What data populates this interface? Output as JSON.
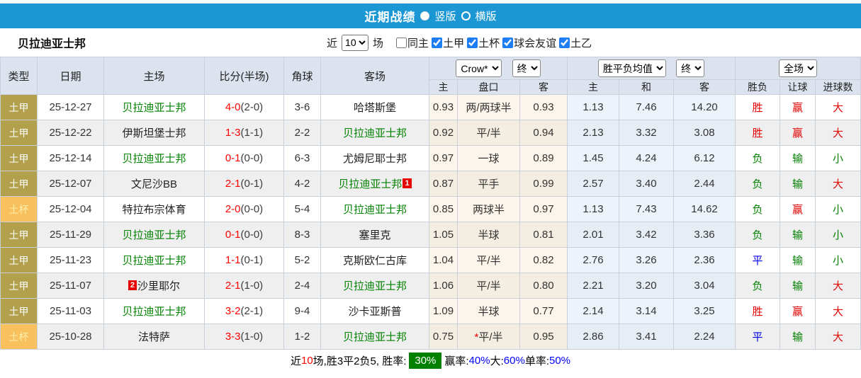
{
  "topbar": {
    "title": "近期战绩",
    "view_options": [
      {
        "label": "竖版",
        "selected": true
      },
      {
        "label": "横版",
        "selected": false
      }
    ]
  },
  "filterbar": {
    "team": "贝拉迪亚士邦",
    "near_label": "近",
    "match_count": "10",
    "matches_suffix": "场",
    "checkboxes": [
      {
        "label": "同主",
        "checked": false
      },
      {
        "label": "土甲",
        "checked": true
      },
      {
        "label": "土杯",
        "checked": true
      },
      {
        "label": "球会友谊",
        "checked": true
      },
      {
        "label": "土乙",
        "checked": true
      }
    ]
  },
  "table": {
    "main_headers": [
      "类型",
      "日期",
      "主场",
      "比分(半场)",
      "角球",
      "客场"
    ],
    "dropdowns": {
      "bookmaker": "Crow*",
      "odds_final": "终",
      "avg": "胜平负均值",
      "avg_final": "终",
      "scope": "全场"
    },
    "sub_headers": [
      "主",
      "盘口",
      "客",
      "主",
      "和",
      "客",
      "胜负",
      "让球",
      "进球数"
    ],
    "rows": [
      {
        "type": "土甲",
        "cup": false,
        "date": "25-12-27",
        "home": "贝拉迪亚士邦",
        "home_self": true,
        "home_badge": "",
        "score": "4-0",
        "half": "(2-0)",
        "corners": "3-6",
        "away": "哈塔斯堡",
        "away_self": false,
        "away_badge": "",
        "odds": [
          "0.93",
          "两/两球半",
          "0.93"
        ],
        "star": false,
        "avg": [
          "1.13",
          "7.46",
          "14.20"
        ],
        "results": [
          [
            "胜",
            "r"
          ],
          [
            "赢",
            "r"
          ],
          [
            "大",
            "r"
          ]
        ]
      },
      {
        "type": "土甲",
        "cup": false,
        "date": "25-12-22",
        "home": "伊斯坦堡士邦",
        "home_self": false,
        "home_badge": "",
        "score": "1-3",
        "half": "(1-1)",
        "corners": "2-2",
        "away": "贝拉迪亚士邦",
        "away_self": true,
        "away_badge": "",
        "odds": [
          "0.92",
          "平/半",
          "0.94"
        ],
        "star": false,
        "avg": [
          "2.13",
          "3.32",
          "3.08"
        ],
        "results": [
          [
            "胜",
            "r"
          ],
          [
            "赢",
            "r"
          ],
          [
            "大",
            "r"
          ]
        ]
      },
      {
        "type": "土甲",
        "cup": false,
        "date": "25-12-14",
        "home": "贝拉迪亚士邦",
        "home_self": true,
        "home_badge": "",
        "score": "0-1",
        "half": "(0-0)",
        "corners": "6-3",
        "away": "尤姆尼耶士邦",
        "away_self": false,
        "away_badge": "",
        "odds": [
          "0.97",
          "一球",
          "0.89"
        ],
        "star": false,
        "avg": [
          "1.45",
          "4.24",
          "6.12"
        ],
        "results": [
          [
            "负",
            "g"
          ],
          [
            "输",
            "g"
          ],
          [
            "小",
            "g"
          ]
        ]
      },
      {
        "type": "土甲",
        "cup": false,
        "date": "25-12-07",
        "home": "文尼沙BB",
        "home_self": false,
        "home_badge": "",
        "score": "2-1",
        "half": "(0-1)",
        "corners": "4-2",
        "away": "贝拉迪亚士邦",
        "away_self": true,
        "away_badge": "1",
        "odds": [
          "0.87",
          "平手",
          "0.99"
        ],
        "star": false,
        "avg": [
          "2.57",
          "3.40",
          "2.44"
        ],
        "results": [
          [
            "负",
            "g"
          ],
          [
            "输",
            "g"
          ],
          [
            "大",
            "r"
          ]
        ]
      },
      {
        "type": "土杯",
        "cup": true,
        "date": "25-12-04",
        "home": "特拉布宗体育",
        "home_self": false,
        "home_badge": "",
        "score": "2-0",
        "half": "(0-0)",
        "corners": "5-4",
        "away": "贝拉迪亚士邦",
        "away_self": true,
        "away_badge": "",
        "odds": [
          "0.85",
          "两球半",
          "0.97"
        ],
        "star": false,
        "avg": [
          "1.13",
          "7.43",
          "14.62"
        ],
        "results": [
          [
            "负",
            "g"
          ],
          [
            "赢",
            "r"
          ],
          [
            "小",
            "g"
          ]
        ]
      },
      {
        "type": "土甲",
        "cup": false,
        "date": "25-11-29",
        "home": "贝拉迪亚士邦",
        "home_self": true,
        "home_badge": "",
        "score": "0-1",
        "half": "(0-0)",
        "corners": "8-3",
        "away": "塞里克",
        "away_self": false,
        "away_badge": "",
        "odds": [
          "1.05",
          "半球",
          "0.81"
        ],
        "star": false,
        "avg": [
          "2.01",
          "3.42",
          "3.36"
        ],
        "results": [
          [
            "负",
            "g"
          ],
          [
            "输",
            "g"
          ],
          [
            "小",
            "g"
          ]
        ]
      },
      {
        "type": "土甲",
        "cup": false,
        "date": "25-11-23",
        "home": "贝拉迪亚士邦",
        "home_self": true,
        "home_badge": "",
        "score": "1-1",
        "half": "(0-1)",
        "corners": "5-2",
        "away": "克斯欧仁古库",
        "away_self": false,
        "away_badge": "",
        "odds": [
          "1.04",
          "平/半",
          "0.82"
        ],
        "star": false,
        "avg": [
          "2.76",
          "3.26",
          "2.36"
        ],
        "results": [
          [
            "平",
            "b"
          ],
          [
            "输",
            "g"
          ],
          [
            "小",
            "g"
          ]
        ]
      },
      {
        "type": "土甲",
        "cup": false,
        "date": "25-11-07",
        "home": "沙里耶尔",
        "home_self": false,
        "home_badge": "2",
        "score": "2-1",
        "half": "(1-0)",
        "corners": "2-4",
        "away": "贝拉迪亚士邦",
        "away_self": true,
        "away_badge": "",
        "odds": [
          "1.06",
          "平/半",
          "0.80"
        ],
        "star": false,
        "avg": [
          "2.21",
          "3.20",
          "3.04"
        ],
        "results": [
          [
            "负",
            "g"
          ],
          [
            "输",
            "g"
          ],
          [
            "大",
            "r"
          ]
        ]
      },
      {
        "type": "土甲",
        "cup": false,
        "date": "25-11-03",
        "home": "贝拉迪亚士邦",
        "home_self": true,
        "home_badge": "",
        "score": "3-2",
        "half": "(2-1)",
        "corners": "9-4",
        "away": "沙卡亚斯普",
        "away_self": false,
        "away_badge": "",
        "odds": [
          "1.09",
          "半球",
          "0.77"
        ],
        "star": false,
        "avg": [
          "2.14",
          "3.14",
          "3.25"
        ],
        "results": [
          [
            "胜",
            "r"
          ],
          [
            "赢",
            "r"
          ],
          [
            "大",
            "r"
          ]
        ]
      },
      {
        "type": "土杯",
        "cup": true,
        "date": "25-10-28",
        "home": "法特萨",
        "home_self": false,
        "home_badge": "",
        "score": "3-3",
        "half": "(1-0)",
        "corners": "1-2",
        "away": "贝拉迪亚士邦",
        "away_self": true,
        "away_badge": "",
        "odds": [
          "0.75",
          "平/半",
          "0.95"
        ],
        "star": true,
        "avg": [
          "2.86",
          "3.41",
          "2.24"
        ],
        "results": [
          [
            "平",
            "b"
          ],
          [
            "输",
            "g"
          ],
          [
            "大",
            "r"
          ]
        ]
      }
    ]
  },
  "summary": {
    "segments": [
      {
        "text": "近",
        "style": "k"
      },
      {
        "text": "10",
        "style": "r"
      },
      {
        "text": "场,胜3平2负5, 胜率:",
        "style": "k"
      },
      {
        "text": "30%",
        "style": "badge"
      },
      {
        "text": "赢率:",
        "style": "k"
      },
      {
        "text": "40%",
        "style": "b"
      },
      {
        "text": " 大:",
        "style": "k"
      },
      {
        "text": "60%",
        "style": "b"
      },
      {
        "text": " 单率:",
        "style": "k"
      },
      {
        "text": "50%",
        "style": "b"
      }
    ]
  },
  "colors": {
    "topbar_blue": "#1b97d4",
    "header_bg": "#dce3ee",
    "league_type_bg": "#b2a04c",
    "cup_type_bg": "#f8c15d",
    "self_team_green": "#008000",
    "score_red": "#ff0000",
    "result_red": "#e60000",
    "result_green": "#008000",
    "result_blue": "#0000ee",
    "odds_col_bg": "#fcf5eb",
    "avg_col_bg": "#ecf3fb",
    "win_rate_badge_bg": "#008000"
  }
}
